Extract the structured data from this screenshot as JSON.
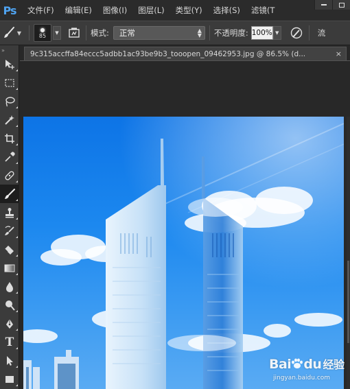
{
  "app": {
    "logo": "Ps"
  },
  "menu": {
    "items": [
      "文件(F)",
      "编辑(E)",
      "图像(I)",
      "图层(L)",
      "类型(Y)",
      "选择(S)",
      "滤镜(T"
    ]
  },
  "options_bar": {
    "brush_size": "85",
    "mode_label": "模式:",
    "mode_value": "正常",
    "opacity_label": "不透明度:",
    "opacity_value": "100%",
    "flow_label": "流"
  },
  "document": {
    "tab_title": "9c315accffa84eccc5adbb1ac93be9b3_tooopen_09462953.jpg @ 86.5% (d...",
    "close_glyph": "×"
  },
  "tools": [
    {
      "name": "move-tool",
      "icon": "move-icon"
    },
    {
      "name": "marquee-tool",
      "icon": "marquee-icon"
    },
    {
      "name": "lasso-tool",
      "icon": "lasso-icon"
    },
    {
      "name": "magic-wand-tool",
      "icon": "magic-wand-icon"
    },
    {
      "name": "crop-tool",
      "icon": "crop-icon"
    },
    {
      "name": "eyedropper-tool",
      "icon": "eyedropper-icon"
    },
    {
      "name": "healing-brush-tool",
      "icon": "bandage-icon"
    },
    {
      "name": "brush-tool",
      "icon": "brush-icon",
      "active": true
    },
    {
      "name": "clone-stamp-tool",
      "icon": "stamp-icon"
    },
    {
      "name": "history-brush-tool",
      "icon": "history-brush-icon"
    },
    {
      "name": "eraser-tool",
      "icon": "eraser-icon"
    },
    {
      "name": "gradient-tool",
      "icon": "gradient-icon"
    },
    {
      "name": "blur-tool",
      "icon": "blur-icon"
    },
    {
      "name": "dodge-tool",
      "icon": "dodge-icon"
    },
    {
      "name": "pen-tool",
      "icon": "pen-icon"
    },
    {
      "name": "type-tool",
      "icon": "type-icon",
      "glyph": "T"
    },
    {
      "name": "path-selection-tool",
      "icon": "path-select-icon"
    },
    {
      "name": "rectangle-tool",
      "icon": "rectangle-icon"
    }
  ],
  "watermark": {
    "brand": "Bai",
    "brand2": "du",
    "cn": "经验",
    "url": "jingyan.baidu.com"
  },
  "colors": {
    "menubar": "#2b2b2b",
    "panel": "#3b3b3b",
    "sky": "#1c88ef",
    "ps_blue": "#4fa3f0"
  }
}
